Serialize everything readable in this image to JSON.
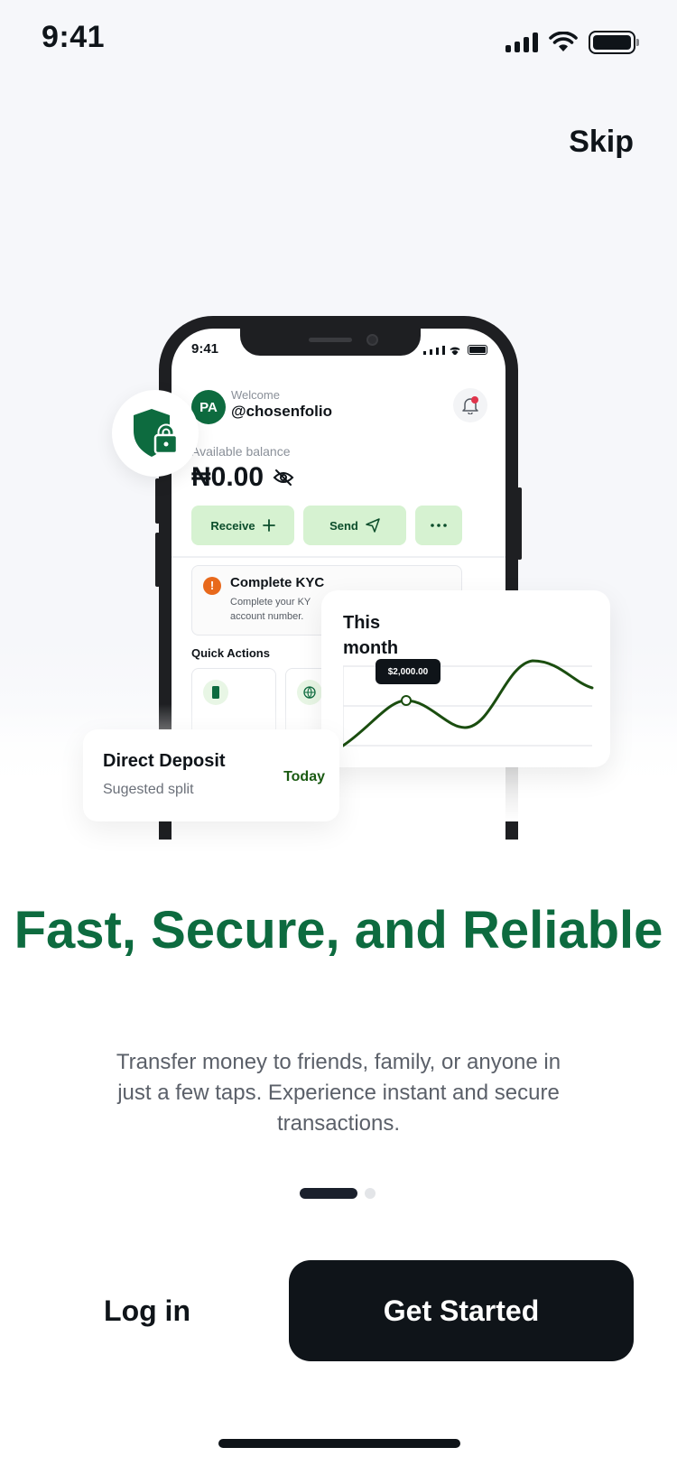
{
  "status_bar": {
    "time": "9:41"
  },
  "header": {
    "skip_label": "Skip"
  },
  "mockup": {
    "status_time": "9:41",
    "avatar_initials": "PA",
    "welcome_label": "Welcome",
    "handle": "@chosenfolio",
    "balance_label": "Available balance",
    "balance_value": "₦0.00",
    "receive_label": "Receive",
    "send_label": "Send",
    "kyc_title": "Complete KYC",
    "kyc_line1": "Complete your KY",
    "kyc_line2": "account number.",
    "quick_actions_title": "Quick Actions"
  },
  "month_card": {
    "title": "This month",
    "tooltip": "$2,000.00"
  },
  "deposit_card": {
    "title": "Direct Deposit",
    "subtitle": "Sugested split",
    "date": "Today"
  },
  "onboarding": {
    "headline": "Fast, Secure, and Reliable",
    "description": "Transfer money to friends, family, or anyone in just a few taps. Experience instant and secure transactions.",
    "page_index": 1,
    "page_count": 2
  },
  "actions": {
    "login_label": "Log in",
    "get_started_label": "Get Started"
  },
  "colors": {
    "brand_green": "#0d6b3f",
    "chart_line": "#1a4d0f",
    "dark": "#0f1419",
    "light_green": "#d6f2d1",
    "alert_orange": "#e8691c"
  }
}
